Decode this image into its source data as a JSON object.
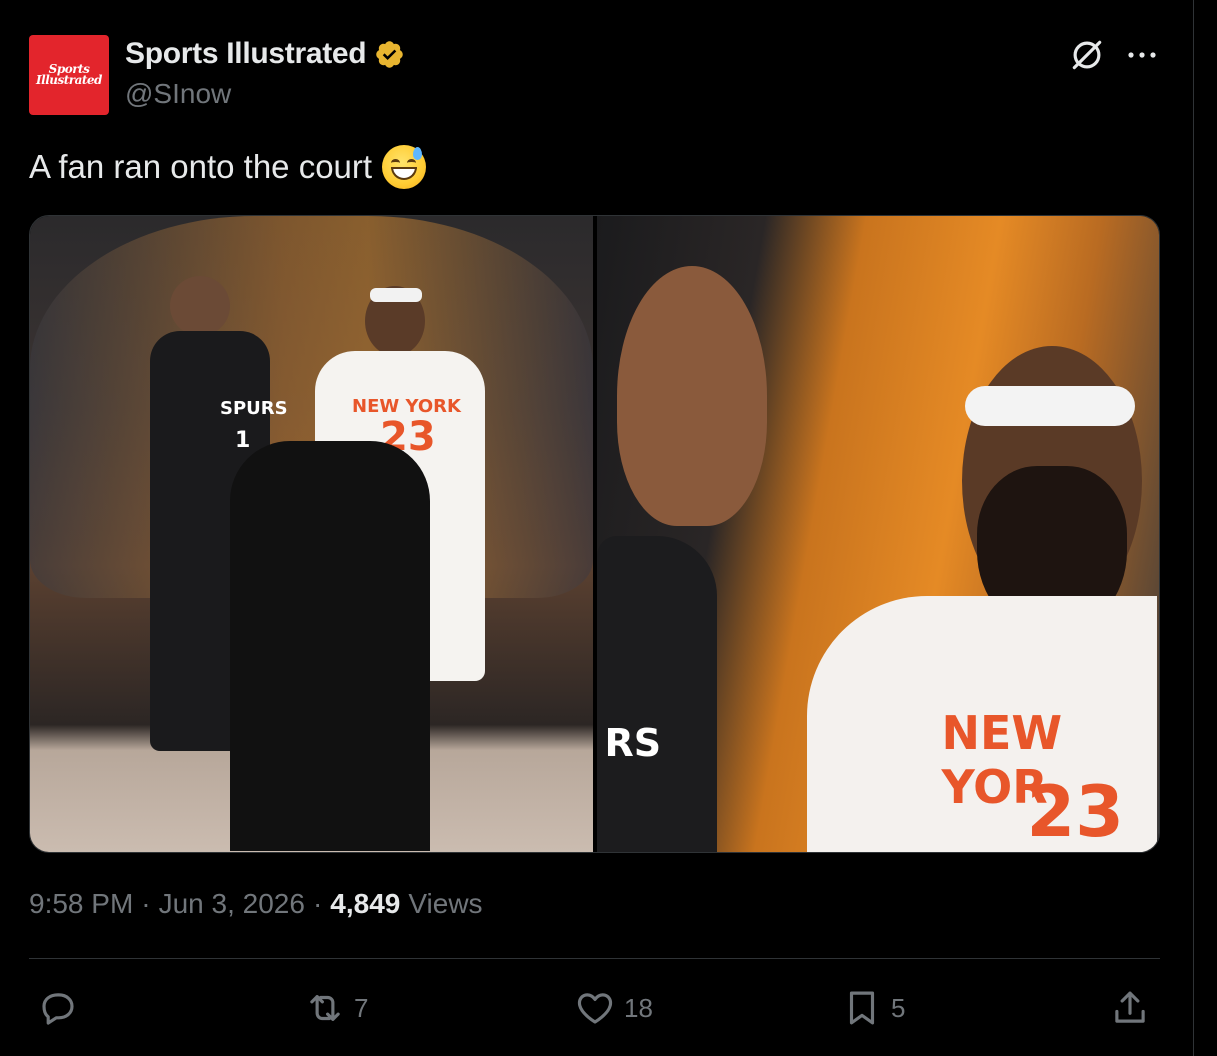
{
  "author": {
    "display_name": "Sports Illustrated",
    "handle": "@SInow",
    "avatar_text_line1": "Sports",
    "avatar_text_line2": "Illustrated",
    "avatar_color": "#e3252c",
    "verified_badge_color": "#e8b530"
  },
  "tweet": {
    "text": "A fan ran onto the court",
    "emoji": "sweat-smile-emoji"
  },
  "media": {
    "images": [
      {
        "name": "court-photo-left"
      },
      {
        "name": "closeup-photo-right"
      }
    ]
  },
  "meta": {
    "time": "9:58 PM",
    "separator1": "·",
    "date": "Jun 3, 2026",
    "separator2": "·",
    "views_count": "4,849",
    "views_label": "Views"
  },
  "actions": {
    "reply": {
      "icon": "reply-icon",
      "count": ""
    },
    "repost": {
      "icon": "repost-icon",
      "count": "7"
    },
    "like": {
      "icon": "heart-icon",
      "count": "18"
    },
    "bookmark": {
      "icon": "bookmark-icon",
      "count": "5"
    },
    "share": {
      "icon": "share-icon",
      "count": ""
    }
  },
  "colors": {
    "background": "#000000",
    "text_primary": "#e7e9ea",
    "text_secondary": "#71767b",
    "border": "#2f3336"
  }
}
